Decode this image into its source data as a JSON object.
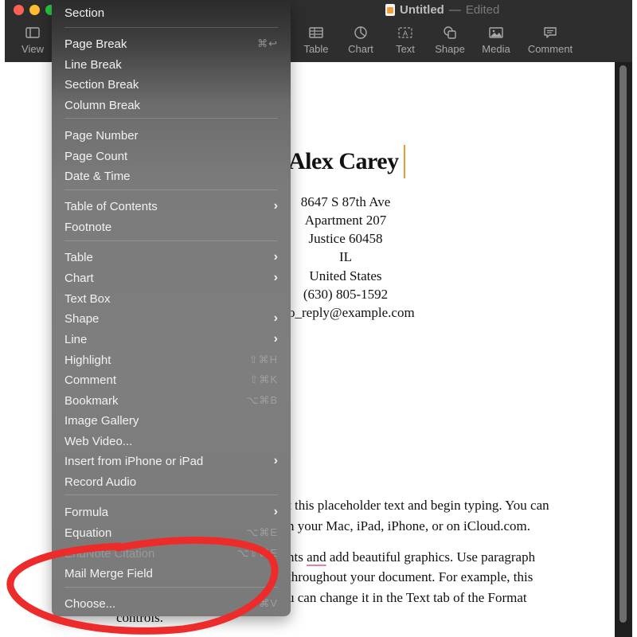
{
  "window": {
    "title": "Untitled",
    "title_separator": "—",
    "status": "Edited"
  },
  "toolbar": {
    "view": "View",
    "table": "Table",
    "chart": "Chart",
    "text": "Text",
    "shape": "Shape",
    "media": "Media",
    "comment": "Comment"
  },
  "document": {
    "name": "Alex Carey",
    "address_lines": [
      "8647 S 87th Ave",
      "Apartment 207",
      "Justice 60458",
      "IL",
      "United States",
      "(630) 805-1592",
      "o_reply@example.com"
    ],
    "body_lines": [
      "t this placeholder text and begin typing. You can",
      "n your Mac, iPad, iPhone, or on iCloud.com.",
      "add beautiful graphics. Use paragraph",
      "throughout your document. For example, this",
      "u can change it in the Text tab of the Format",
      "controls."
    ],
    "body_line2_prefix": "nts ",
    "body_line2_flagged_word": "and"
  },
  "insert_menu": {
    "header": "Section",
    "items": [
      {
        "label": "Page Break",
        "shortcut": "⌘↩",
        "submenu": false,
        "disabled": false
      },
      {
        "label": "Line Break",
        "shortcut": "",
        "submenu": false,
        "disabled": false
      },
      {
        "label": "Section Break",
        "shortcut": "",
        "submenu": false,
        "disabled": false
      },
      {
        "label": "Column Break",
        "shortcut": "",
        "submenu": false,
        "disabled": false
      },
      {
        "label": "Page Number",
        "shortcut": "",
        "submenu": false,
        "disabled": false
      },
      {
        "label": "Page Count",
        "shortcut": "",
        "submenu": false,
        "disabled": false
      },
      {
        "label": "Date & Time",
        "shortcut": "",
        "submenu": false,
        "disabled": false
      },
      {
        "label": "Table of Contents",
        "shortcut": "",
        "submenu": true,
        "disabled": false
      },
      {
        "label": "Footnote",
        "shortcut": "",
        "submenu": false,
        "disabled": false
      },
      {
        "label": "Table",
        "shortcut": "",
        "submenu": true,
        "disabled": false
      },
      {
        "label": "Chart",
        "shortcut": "",
        "submenu": true,
        "disabled": false
      },
      {
        "label": "Text Box",
        "shortcut": "",
        "submenu": false,
        "disabled": false
      },
      {
        "label": "Shape",
        "shortcut": "",
        "submenu": true,
        "disabled": false
      },
      {
        "label": "Line",
        "shortcut": "",
        "submenu": true,
        "disabled": false
      },
      {
        "label": "Highlight",
        "shortcut": "⇧⌘H",
        "submenu": false,
        "disabled": false
      },
      {
        "label": "Comment",
        "shortcut": "⇧⌘K",
        "submenu": false,
        "disabled": false
      },
      {
        "label": "Bookmark",
        "shortcut": "⌥⌘B",
        "submenu": false,
        "disabled": false
      },
      {
        "label": "Image Gallery",
        "shortcut": "",
        "submenu": false,
        "disabled": false
      },
      {
        "label": "Web Video...",
        "shortcut": "",
        "submenu": false,
        "disabled": false
      },
      {
        "label": "Insert from iPhone or iPad",
        "shortcut": "",
        "submenu": true,
        "disabled": false
      },
      {
        "label": "Record Audio",
        "shortcut": "",
        "submenu": false,
        "disabled": false
      },
      {
        "label": "Formula",
        "shortcut": "",
        "submenu": true,
        "disabled": false
      },
      {
        "label": "Equation",
        "shortcut": "⌥⌘E",
        "submenu": false,
        "disabled": false
      },
      {
        "label": "EndNote Citation",
        "shortcut": "⌥⇧⌘E",
        "submenu": false,
        "disabled": true
      },
      {
        "label": "Mail Merge Field",
        "shortcut": "",
        "submenu": true,
        "disabled": false
      },
      {
        "label": "Choose...",
        "shortcut": "⇧⌘V",
        "submenu": false,
        "disabled": false
      }
    ]
  },
  "annotation": {
    "color": "#ee2b2b",
    "highlights": "Mail Merge Field"
  },
  "colors": {
    "cursor": "#f29a2e",
    "spell_underline": "#e8809a"
  }
}
